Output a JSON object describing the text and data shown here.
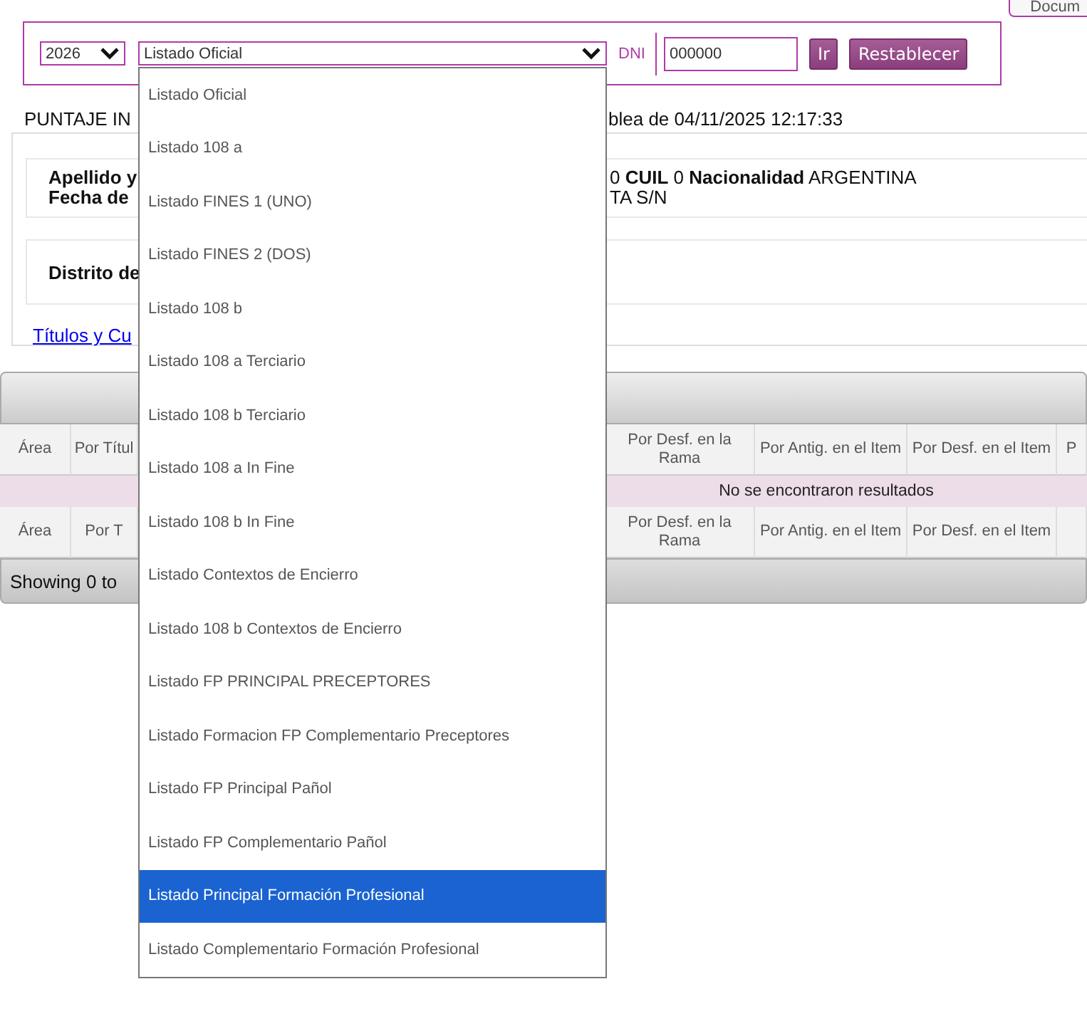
{
  "top_tab": {
    "label": "Docum"
  },
  "filters": {
    "year": "2026",
    "listado": "Listado Oficial",
    "dni_label": "DNI",
    "dni": {
      "value": "000000"
    },
    "buttons": [
      "Ir",
      "Restablecer"
    ]
  },
  "listado_options": [
    {
      "label": "Listado Oficial",
      "selected": false
    },
    {
      "label": "Listado 108 a",
      "selected": false
    },
    {
      "label": "Listado FINES 1 (UNO)",
      "selected": false
    },
    {
      "label": "Listado FINES 2 (DOS)",
      "selected": false
    },
    {
      "label": "Listado 108 b",
      "selected": false
    },
    {
      "label": "Listado 108 a Terciario",
      "selected": false
    },
    {
      "label": "Listado 108 b Terciario",
      "selected": false
    },
    {
      "label": "Listado 108 a In Fine",
      "selected": false
    },
    {
      "label": "Listado 108 b In Fine",
      "selected": false
    },
    {
      "label": "Listado Contextos de Encierro",
      "selected": false
    },
    {
      "label": "Listado 108 b Contextos de Encierro",
      "selected": false
    },
    {
      "label": "Listado FP PRINCIPAL PRECEPTORES",
      "selected": false
    },
    {
      "label": "Listado Formacion FP Complementario Preceptores",
      "selected": false
    },
    {
      "label": "Listado FP Principal Pañol",
      "selected": false
    },
    {
      "label": "Listado FP Complementario Pañol",
      "selected": false
    },
    {
      "label": "Listado Principal Formación Profesional",
      "selected": true
    },
    {
      "label": "Listado Complementario Formación Profesional",
      "selected": false
    }
  ],
  "heading": {
    "left": "PUNTAJE IN",
    "right": "blea de 04/11/2025 12:17:33"
  },
  "info_rows": [
    {
      "left": "Apellido y",
      "right": "0  **CUIL** 0  **Nacionalidad** ARGENTINA"
    },
    {
      "left": "Fecha de",
      "right": "TA S/N"
    }
  ],
  "distrito": "Distrito de",
  "link": "Títulos y Cu",
  "table": {
    "header_left": [
      "Área",
      "Por Títul"
    ],
    "header_right": [
      "Por Desf. en la Rama",
      "Por Antig. en el Item",
      "Por Desf. en el Item",
      "P"
    ],
    "empty_message": "No se encontraron resultados",
    "footer_left": [
      "Área",
      "Por T"
    ],
    "footer_right": [
      "Por Desf. en la Rama",
      "Por Antig. en el Item",
      "Por Desf. en el Item"
    ],
    "status": "Showing 0 to"
  }
}
